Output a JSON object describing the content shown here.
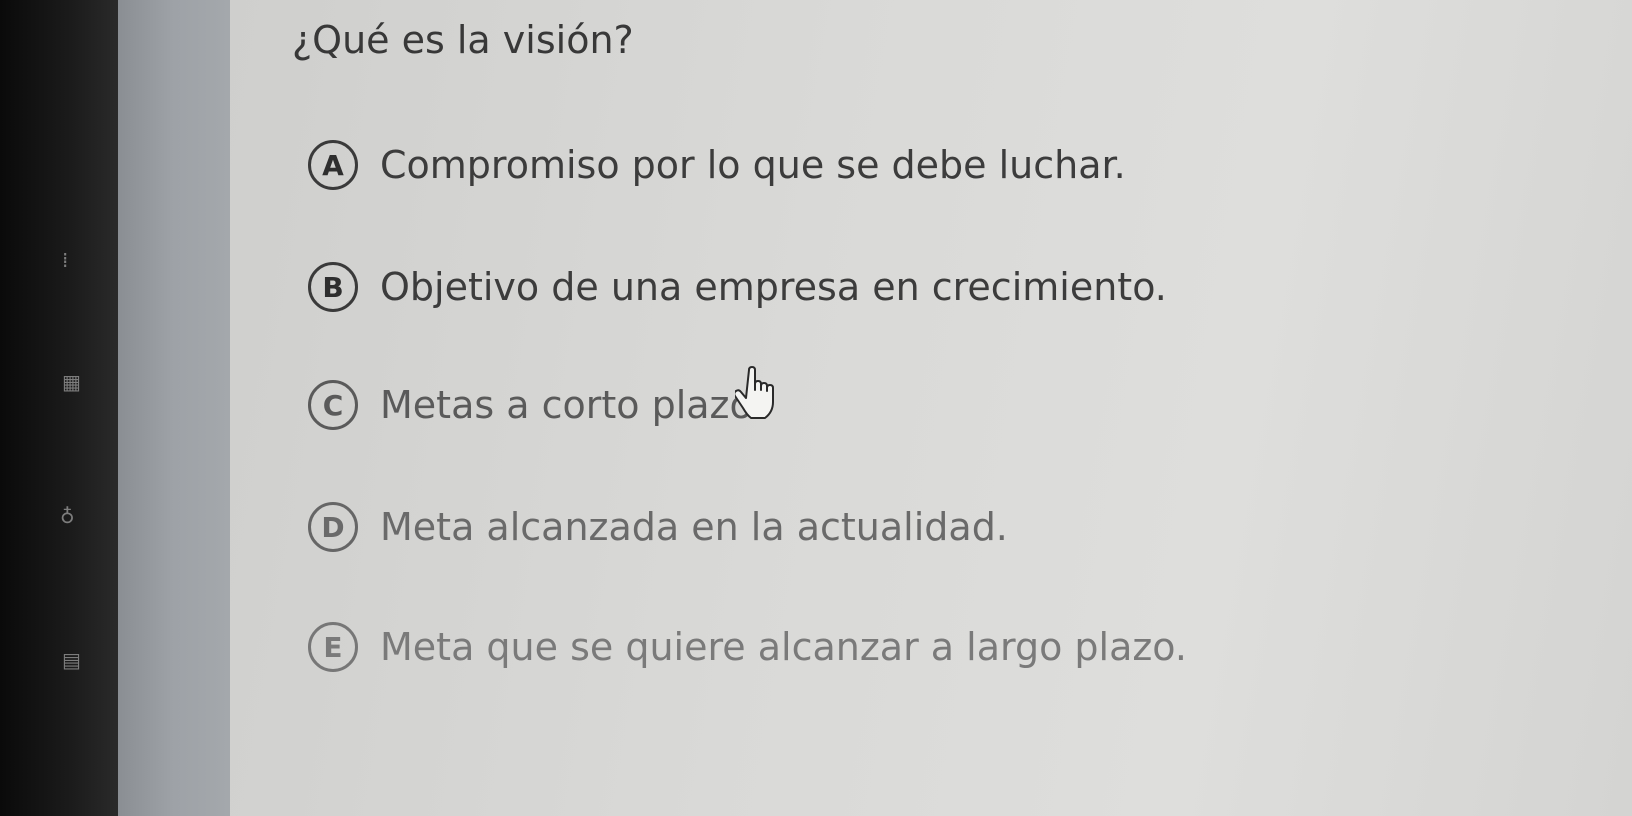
{
  "quiz": {
    "question": "¿Qué es la visión?",
    "options": [
      {
        "letter": "A",
        "text": "Compromiso por lo que se debe luchar."
      },
      {
        "letter": "B",
        "text": "Objetivo de una empresa en crecimiento."
      },
      {
        "letter": "C",
        "text": "Metas a corto plazo."
      },
      {
        "letter": "D",
        "text": "Meta alcanzada en la actualidad."
      },
      {
        "letter": "E",
        "text": "Meta que se quiere alcanzar a largo plazo."
      }
    ]
  },
  "icons": {
    "cursor": "hand-pointer-icon"
  }
}
